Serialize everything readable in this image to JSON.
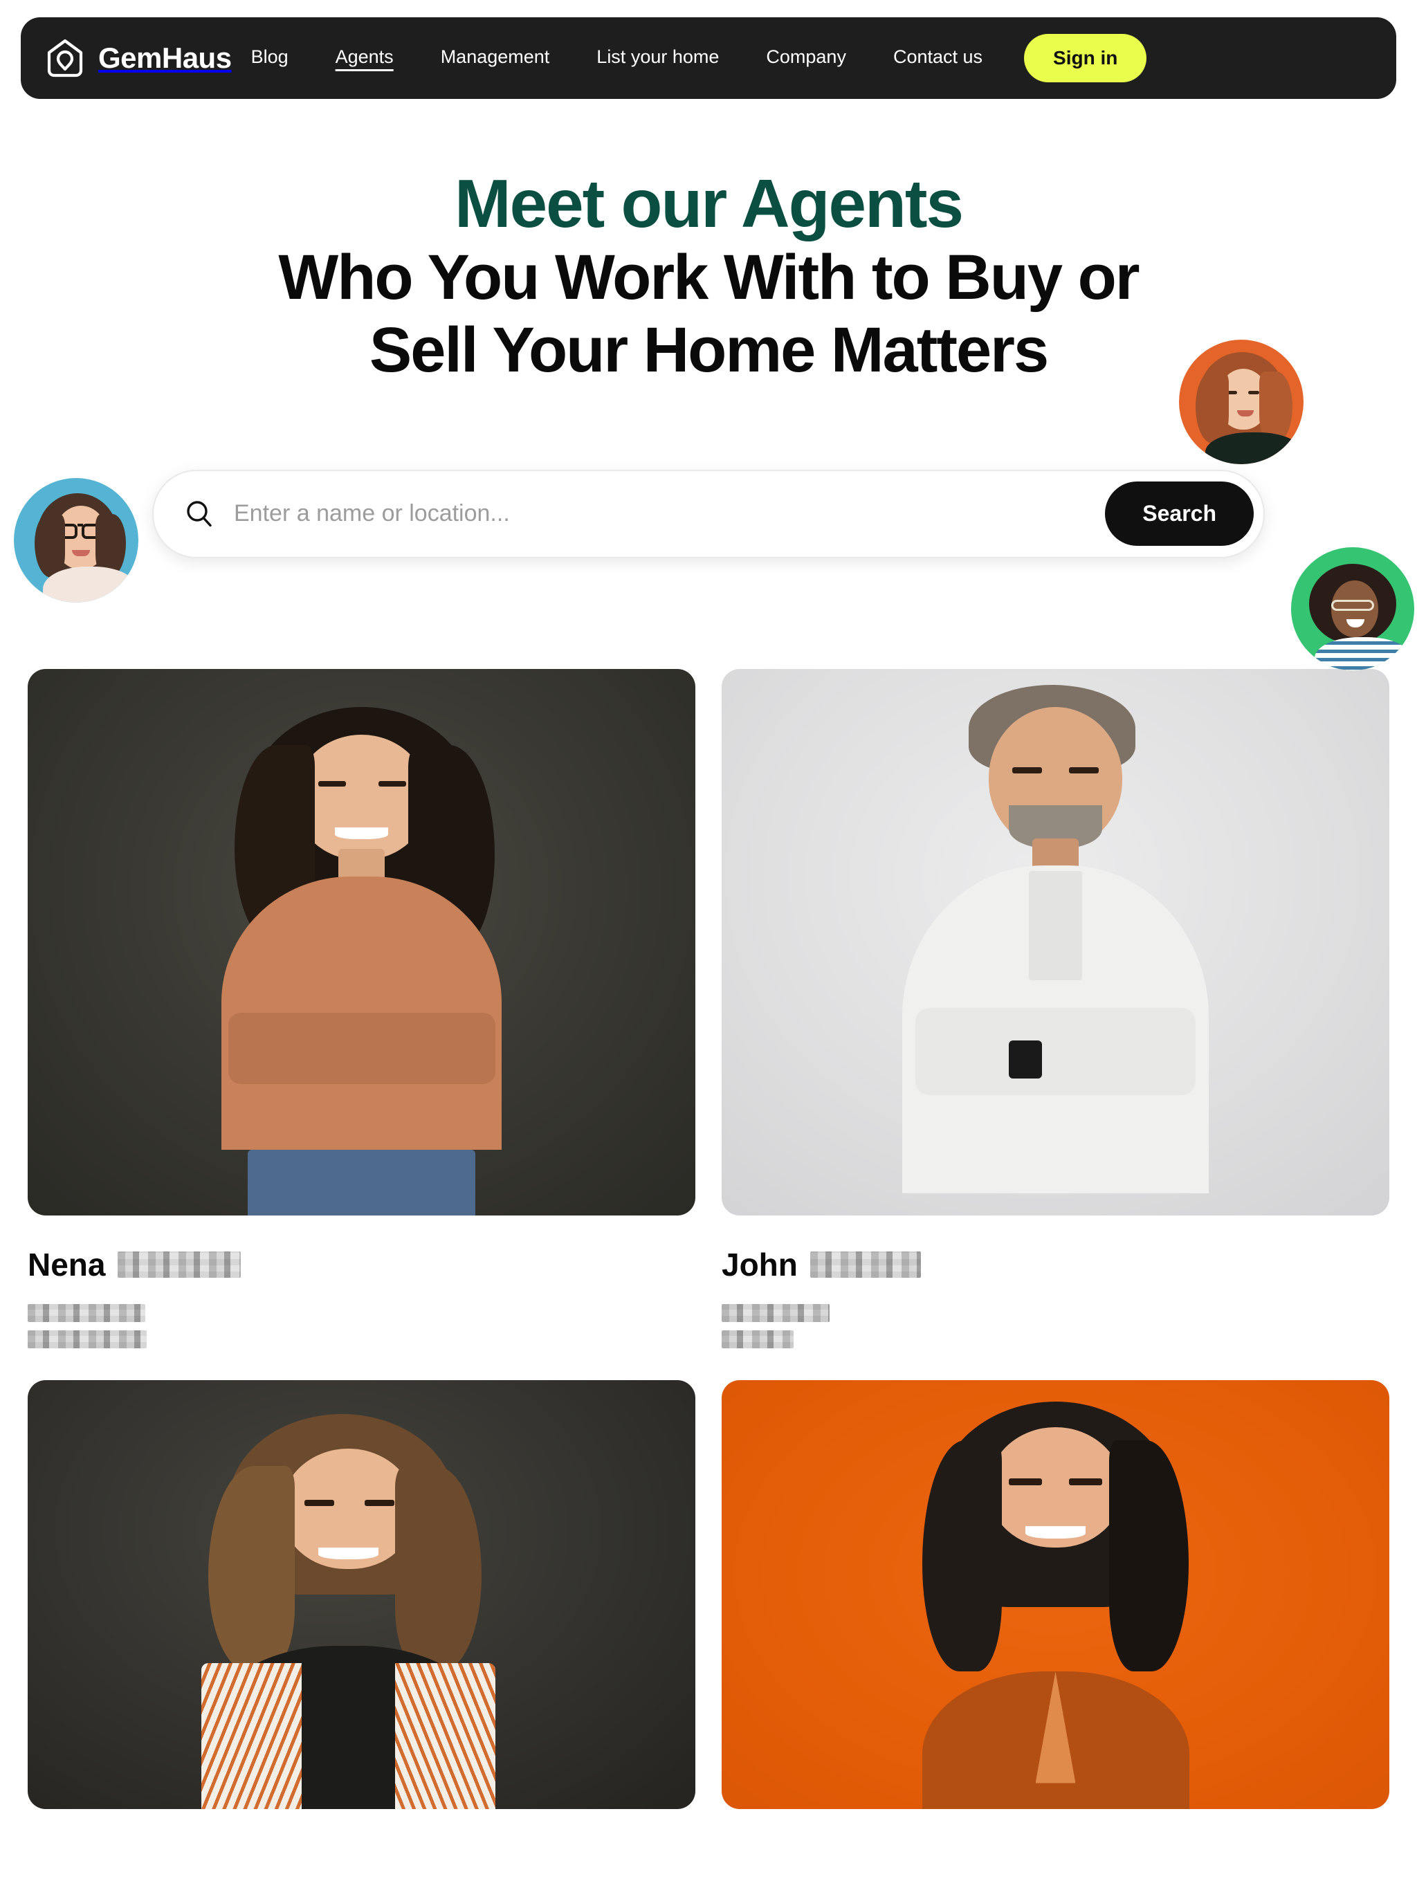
{
  "nav": {
    "brand": "GemHaus",
    "logo_icon": "house-gem-logo-icon",
    "links": [
      {
        "label": "Blog",
        "active": false
      },
      {
        "label": "Agents",
        "active": true
      },
      {
        "label": "Management",
        "active": false
      },
      {
        "label": "List your home",
        "active": false
      },
      {
        "label": "Company",
        "active": false
      },
      {
        "label": "Contact us",
        "active": false
      }
    ],
    "signin_label": "Sign in",
    "signin_bg": "#E8FD4C",
    "bar_bg": "#1E1E1E"
  },
  "hero": {
    "eyebrow": "Meet our Agents",
    "eyebrow_color": "#0B4F43",
    "title": "Who You Work With to Buy or Sell Your Home Matters",
    "title_color": "#0A0A0A",
    "avatars": [
      {
        "name": "avatar-woman-glasses-blue",
        "bg": "#55B4D4",
        "position": "left"
      },
      {
        "name": "avatar-woman-curlyhair-orange",
        "bg": "#E4642A",
        "position": "top-right"
      },
      {
        "name": "avatar-woman-afro-green",
        "bg": "#34C472",
        "position": "bottom-right"
      }
    ]
  },
  "search": {
    "icon": "search-icon",
    "placeholder": "Enter a name or location...",
    "value": "",
    "button_label": "Search",
    "button_bg": "#101010"
  },
  "agents": [
    {
      "first_name": "Nena",
      "last_name_redacted": true,
      "photo": "agent-photo-woman-dark-background",
      "photo_bg": "#3a3933",
      "meta_redacted_lines": 2
    },
    {
      "first_name": "John",
      "last_name_redacted": true,
      "photo": "agent-photo-man-light-background",
      "photo_bg": "#e0e0e1",
      "meta_redacted_lines": 2
    },
    {
      "first_name": "",
      "last_name_redacted": true,
      "photo": "agent-photo-woman-dark-background-2",
      "photo_bg": "#353430",
      "meta_redacted_lines": 0
    },
    {
      "first_name": "",
      "last_name_redacted": true,
      "photo": "agent-photo-woman-orange-background",
      "photo_bg": "#e35c07",
      "meta_redacted_lines": 0
    }
  ]
}
